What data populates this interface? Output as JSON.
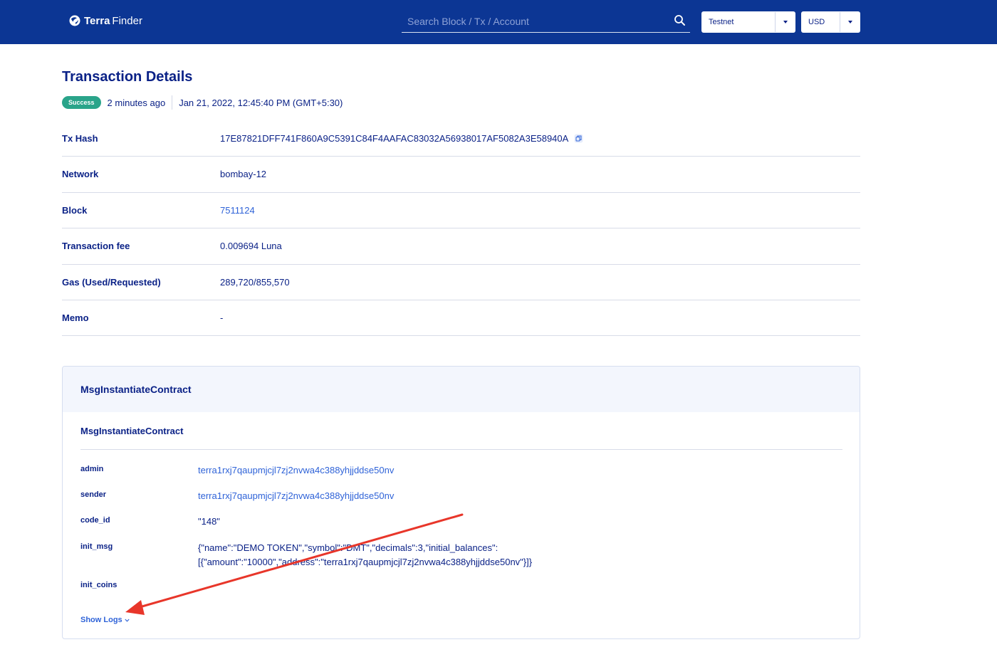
{
  "header": {
    "brand_bold": "Terra",
    "brand_light": "Finder",
    "search_placeholder": "Search Block / Tx / Account",
    "network_selected": "Testnet",
    "currency_selected": "USD"
  },
  "page": {
    "title": "Transaction Details",
    "status_badge": "Success",
    "relative_time": "2 minutes ago",
    "timestamp": "Jan 21, 2022, 12:45:40 PM (GMT+5:30)"
  },
  "details": [
    {
      "label": "Tx Hash",
      "value": "17E87821DFF741F860A9C5391C84F4AAFAC83032A56938017AF5082A3E58940A"
    },
    {
      "label": "Network",
      "value": "bombay-12"
    },
    {
      "label": "Block",
      "value": "7511124"
    },
    {
      "label": "Transaction fee",
      "value": "0.009694 Luna"
    },
    {
      "label": "Gas (Used/Requested)",
      "value": "289,720/855,570"
    },
    {
      "label": "Memo",
      "value": "-"
    }
  ],
  "message": {
    "header_title": "MsgInstantiateContract",
    "sub_title": "MsgInstantiateContract",
    "fields": [
      {
        "key": "admin",
        "value": "terra1rxj7qaupmjcjl7zj2nvwa4c388yhjjddse50nv"
      },
      {
        "key": "sender",
        "value": "terra1rxj7qaupmjcjl7zj2nvwa4c388yhjjddse50nv"
      },
      {
        "key": "code_id",
        "value": "\"148\""
      },
      {
        "key": "init_msg",
        "value_line1": "{\"name\":\"DEMO TOKEN\",\"symbol\":\"DMT\",\"decimals\":3,\"initial_balances\":",
        "value_line2": "[{\"amount\":\"10000\",\"address\":\"terra1rxj7qaupmjcjl7zj2nvwa4c388yhjjddse50nv\"}]}"
      },
      {
        "key": "init_coins",
        "value": ""
      }
    ],
    "show_logs_label": "Show Logs"
  },
  "colors": {
    "header_bg": "#0c3694",
    "primary_text": "#0b2287",
    "link": "#2f63d8",
    "success_badge": "#2aa48a",
    "annotation_arrow": "#e8362a"
  },
  "icons": [
    "terra-logo-icon",
    "search-icon",
    "chevron-down-icon",
    "copy-icon",
    "red-arrow-annotation"
  ]
}
